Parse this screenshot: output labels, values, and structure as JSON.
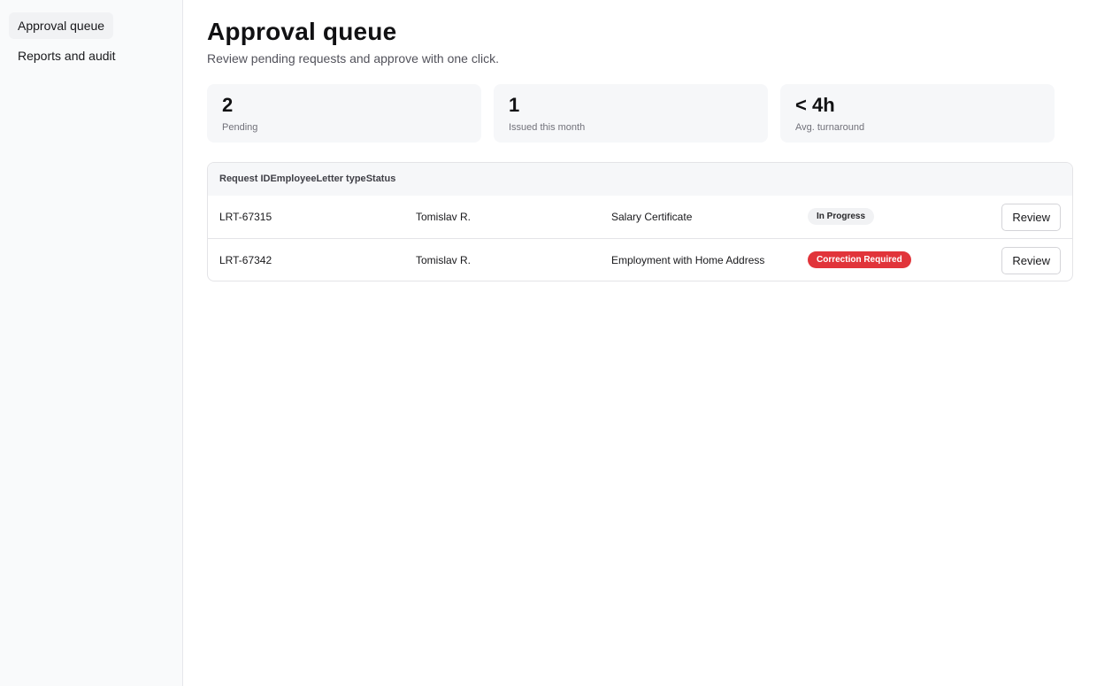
{
  "sidebar": {
    "items": [
      {
        "label": "Approval queue",
        "active": true
      },
      {
        "label": "Reports and audit",
        "active": false
      }
    ]
  },
  "header": {
    "title": "Approval queue",
    "subtitle": "Review pending requests and approve with one click."
  },
  "stats": [
    {
      "value": "2",
      "label": "Pending"
    },
    {
      "value": "1",
      "label": "Issued this month"
    },
    {
      "value": "< 4h",
      "label": "Avg. turnaround"
    }
  ],
  "table": {
    "headers": [
      "Request ID",
      "Employee",
      "Letter type",
      "Status"
    ],
    "rows": [
      {
        "id": "LRT-67315",
        "employee": "Tomislav R.",
        "letter_type": "Salary Certificate",
        "status": "In Progress",
        "action": "Review"
      },
      {
        "id": "LRT-67342",
        "employee": "Tomislav R.",
        "letter_type": "Employment with Home Address",
        "status": "Correction Required",
        "action": "Review"
      }
    ]
  },
  "colors": {
    "correction_badge": "#e1343a",
    "progress_badge": "#f1f2f4",
    "sidebar_bg": "#f9fafb"
  }
}
